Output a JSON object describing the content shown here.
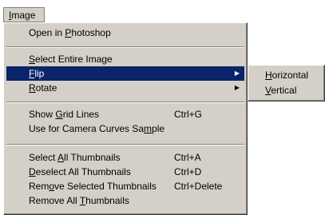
{
  "menubar": {
    "title_prefix": "",
    "title_mnemonic": "I",
    "title_rest": "mage"
  },
  "menu": {
    "open_in_photoshop": {
      "pre": "Open in ",
      "m": "P",
      "post": "hotoshop"
    },
    "select_entire_image": {
      "pre": "",
      "m": "S",
      "post": "elect Entire Image"
    },
    "flip": {
      "pre": "",
      "m": "F",
      "post": "lip"
    },
    "rotate": {
      "pre": "",
      "m": "R",
      "post": "otate"
    },
    "show_grid_lines": {
      "pre": "Show ",
      "m": "G",
      "post": "rid Lines",
      "shortcut": "Ctrl+G"
    },
    "camera_curves": {
      "pre": "Use for Camera Curves Sa",
      "m": "m",
      "post": "ple"
    },
    "select_all_thumbs": {
      "pre": "Select ",
      "m": "A",
      "post": "ll Thumbnails",
      "shortcut": "Ctrl+A"
    },
    "deselect_all_thumbs": {
      "pre": "",
      "m": "D",
      "post": "eselect All Thumbnails",
      "shortcut": "Ctrl+D"
    },
    "remove_selected": {
      "pre": "Rem",
      "m": "o",
      "post": "ve Selected Thumbnails",
      "shortcut": "Ctrl+Delete"
    },
    "remove_all": {
      "pre": "Remove All ",
      "m": "T",
      "post": "humbnails"
    }
  },
  "submenu": {
    "horizontal": {
      "pre": "",
      "m": "H",
      "post": "orizontal"
    },
    "vertical": {
      "pre": "",
      "m": "V",
      "post": "ertical"
    }
  },
  "icons": {
    "submenu_arrow": "▶"
  },
  "colors": {
    "menu_bg": "#d4d0c8",
    "highlight": "#0a246a"
  }
}
